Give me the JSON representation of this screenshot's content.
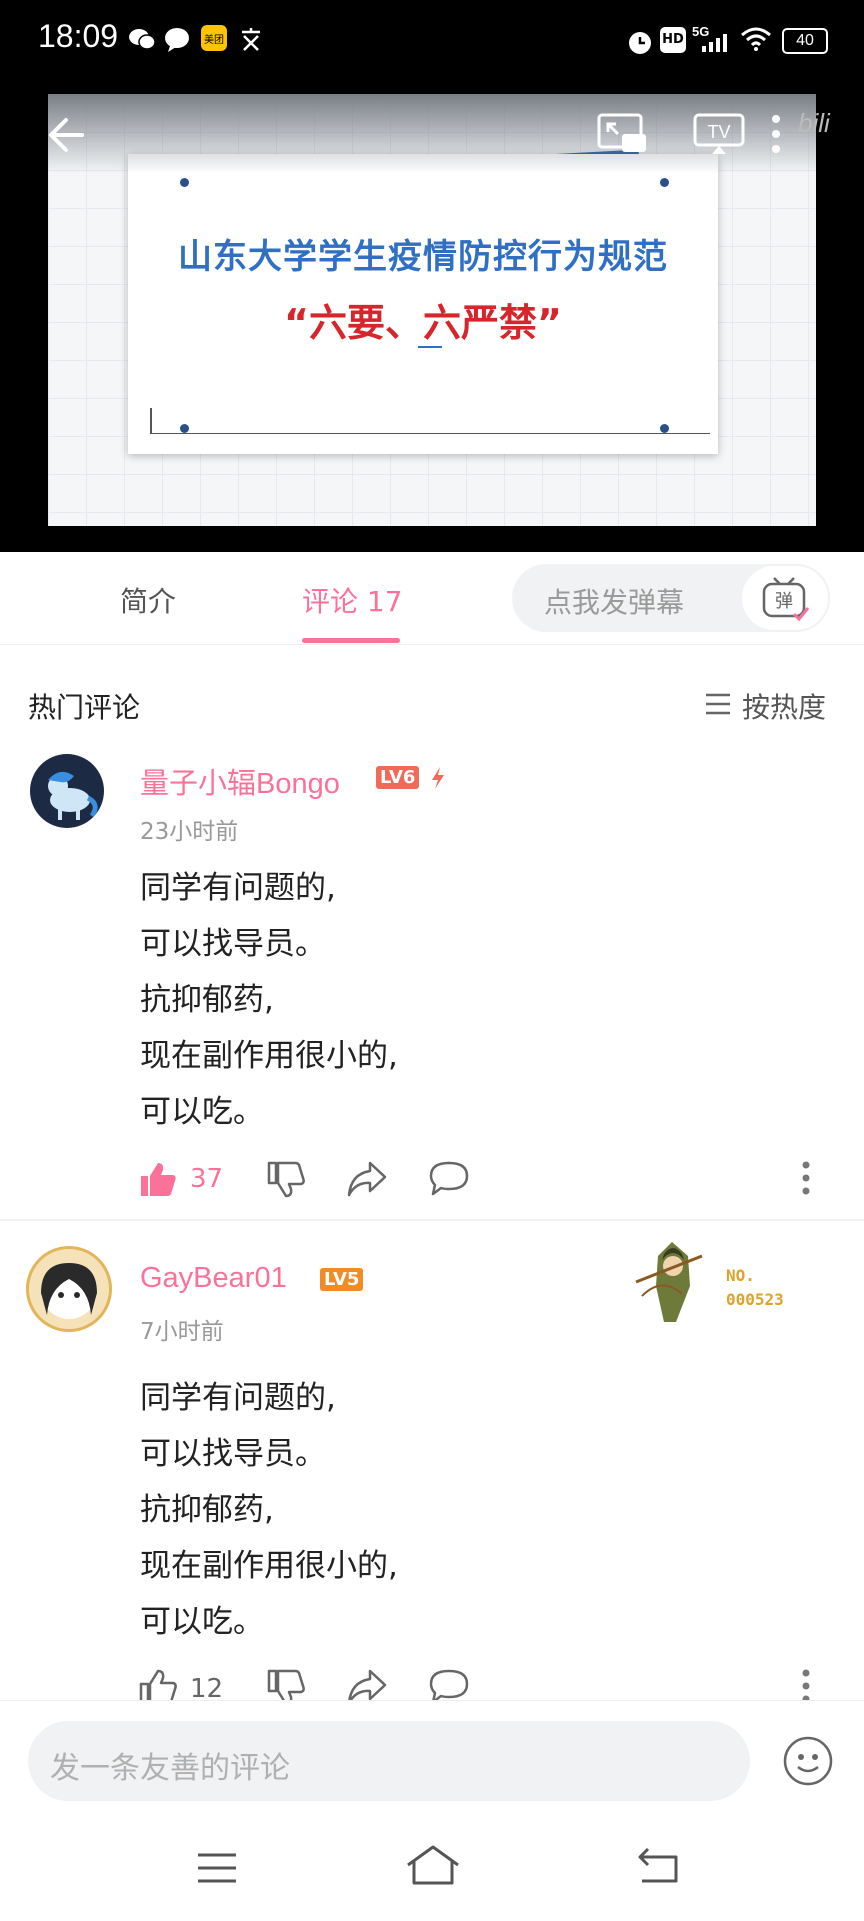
{
  "status": {
    "time": "18:09",
    "battery": "40",
    "network": "5G",
    "hd": "HD"
  },
  "video": {
    "slide_title": "山东大学学生疫情防控行为规范",
    "slide_subtitle": "“六要、六严禁”",
    "brand": "bili"
  },
  "tabs": [
    {
      "label": "简介"
    },
    {
      "label": "评论 17",
      "active": true
    }
  ],
  "danmaku": {
    "placeholder": "点我发弹幕",
    "button_label": "弹"
  },
  "comments_header": {
    "title": "热门评论",
    "sort_label": "按热度"
  },
  "comments": [
    {
      "username": "量子小辐Bongo",
      "level": "LV6",
      "time": "23小时前",
      "lines": [
        "同学有问题的,",
        "可以找导员。",
        "抗抑郁药,",
        "现在副作用很小的,",
        "可以吃。"
      ],
      "likes": "37"
    },
    {
      "username": "GayBear01",
      "level": "LV5",
      "time": "7小时前",
      "badge_label": "NO.",
      "badge_number": "000523",
      "lines": [
        "同学有问题的,",
        "可以找导员。",
        "抗抑郁药,",
        "现在副作用很小的,",
        "可以吃。"
      ],
      "likes": "12"
    }
  ],
  "comment_box": {
    "placeholder": "发一条友善的评论"
  },
  "colors": {
    "accent": "#fb7299",
    "level6": "#f06a5a",
    "level5": "#f08c23"
  }
}
